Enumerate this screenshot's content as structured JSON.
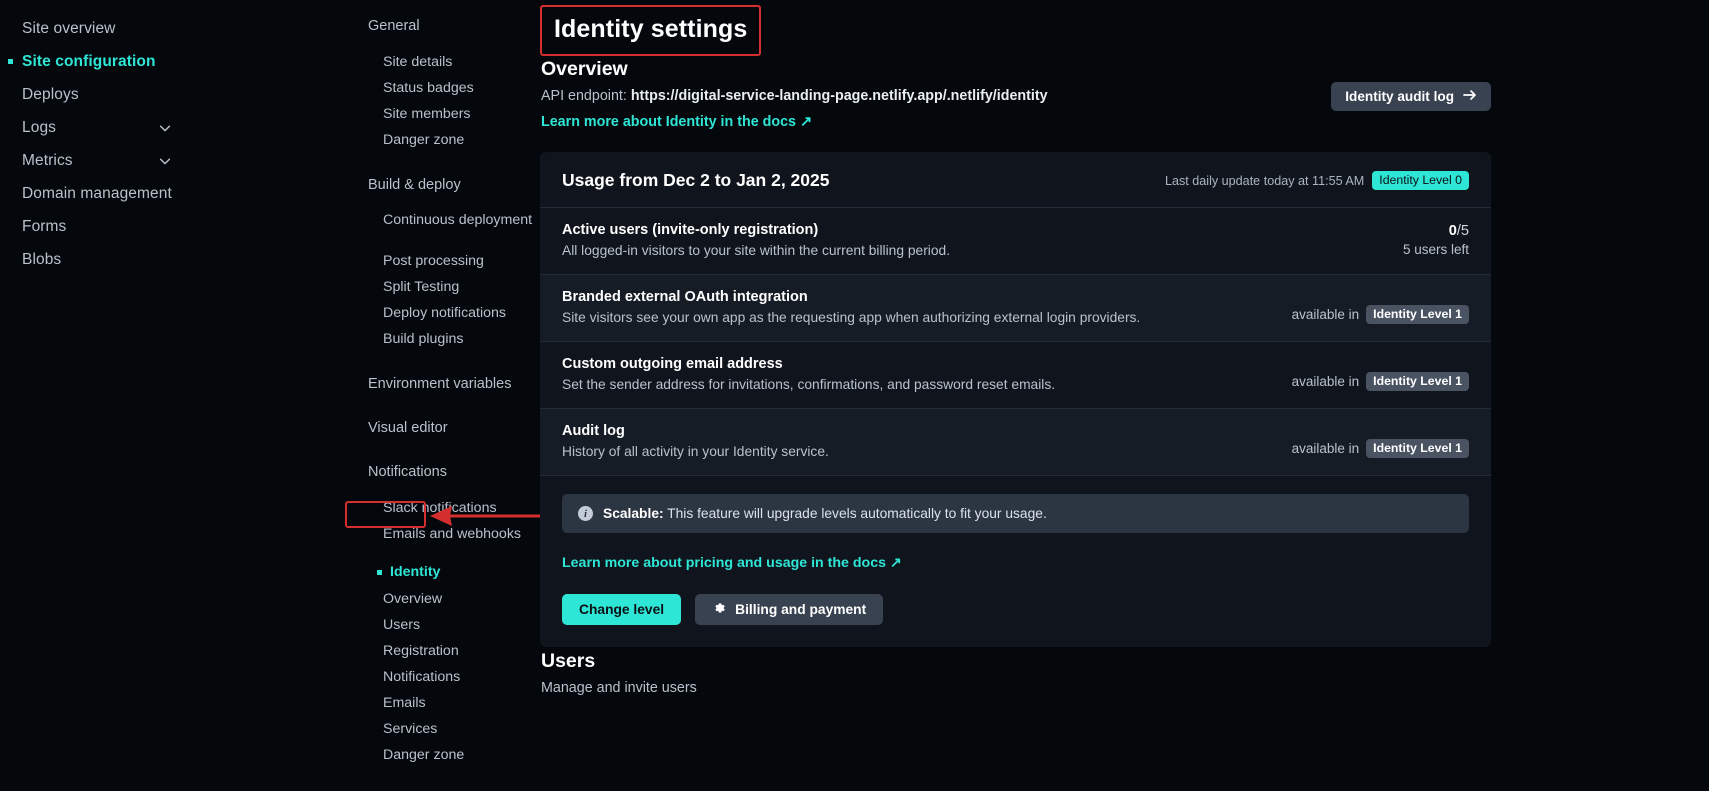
{
  "primary_nav": {
    "items": [
      {
        "label": "Site overview",
        "active": false,
        "caret": false
      },
      {
        "label": "Site configuration",
        "active": true,
        "caret": false
      },
      {
        "label": "Deploys",
        "active": false,
        "caret": false
      },
      {
        "label": "Logs",
        "active": false,
        "caret": true
      },
      {
        "label": "Metrics",
        "active": false,
        "caret": true
      },
      {
        "label": "Domain management",
        "active": false,
        "caret": false
      },
      {
        "label": "Forms",
        "active": false,
        "caret": false
      },
      {
        "label": "Blobs",
        "active": false,
        "caret": false
      }
    ]
  },
  "secondary_nav": {
    "groups": [
      {
        "label": "General"
      },
      {
        "label": "Build & deploy"
      },
      {
        "label": "Environment variables"
      },
      {
        "label": "Visual editor"
      },
      {
        "label": "Notifications"
      }
    ],
    "general_items": [
      "Site details",
      "Status badges",
      "Site members",
      "Danger zone"
    ],
    "build_items": [
      "Continuous deployment",
      "Post processing",
      "Split Testing",
      "Deploy notifications",
      "Build plugins"
    ],
    "notification_items": [
      "Slack notifications",
      "Emails and webhooks"
    ],
    "identity": {
      "label": "Identity"
    },
    "identity_items": [
      "Overview",
      "Users",
      "Registration",
      "Notifications",
      "Emails",
      "Services",
      "Danger zone"
    ]
  },
  "header": {
    "page_title": "Identity settings",
    "overview_heading": "Overview",
    "api_label": "API endpoint: ",
    "api_endpoint": "https://digital-service-landing-page.netlify.app/.netlify/identity",
    "docs_link": "Learn more about Identity in the docs ↗",
    "audit_button": "Identity audit log",
    "audit_button_icon": "arrow-right-icon"
  },
  "usage_card": {
    "title": "Usage from Dec 2 to Jan 2, 2025",
    "last_update": "Last daily update today at 11:55 AM",
    "level_badge": "Identity Level 0",
    "rows": [
      {
        "title": "Active users (invite-only registration)",
        "desc": "All logged-in visitors to your site within the current billing period.",
        "value_strong": "0",
        "value_rest": "/5",
        "value_sub": "5 users left",
        "available_text": "",
        "available_badge": ""
      },
      {
        "title": "Branded external OAuth integration",
        "desc": "Site visitors see your own app as the requesting app when authorizing external login providers.",
        "value_strong": "",
        "value_rest": "",
        "value_sub": "",
        "available_text": "available in",
        "available_badge": "Identity Level 1"
      },
      {
        "title": "Custom outgoing email address",
        "desc": "Set the sender address for invitations, confirmations, and password reset emails.",
        "value_strong": "",
        "value_rest": "",
        "value_sub": "",
        "available_text": "available in",
        "available_badge": "Identity Level 1"
      },
      {
        "title": "Audit log",
        "desc": "History of all activity in your Identity service.",
        "value_strong": "",
        "value_rest": "",
        "value_sub": "",
        "available_text": "available in",
        "available_badge": "Identity Level 1"
      }
    ],
    "info_banner_label": "Scalable:",
    "info_banner_text": " This feature will upgrade levels automatically to fit your usage.",
    "pricing_link": "Learn more about pricing and usage in the docs ↗",
    "change_level_button": "Change level",
    "billing_button": "Billing and payment",
    "billing_button_icon": "gear-icon"
  },
  "users_section": {
    "heading": "Users",
    "subtitle": "Manage and invite users"
  },
  "annotations": {
    "accent_color": "#2ee6d6",
    "highlight_color": "#d32f2f"
  }
}
